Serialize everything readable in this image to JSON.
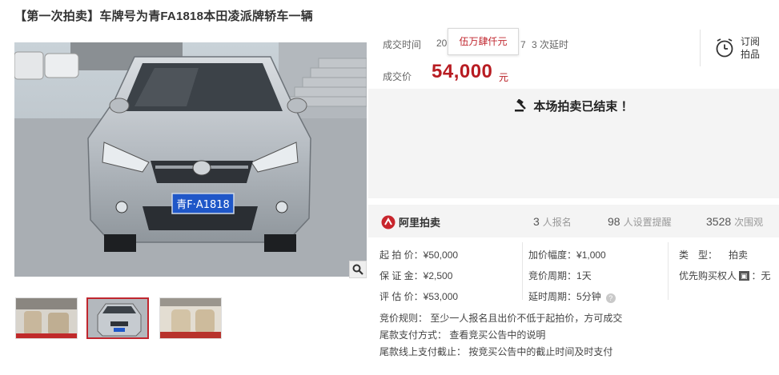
{
  "title": "【第一次拍卖】车牌号为青FA1818本田凌派牌轿车一辆",
  "photos": {
    "main_alt": "青FA1818 本田凌派",
    "plate_text": "青F·A1818",
    "thumbnails": [
      "interior-front",
      "exterior-front",
      "interior-rear"
    ],
    "active_index": 1
  },
  "deal": {
    "time_label": "成交时间",
    "time_value_prefix": "20",
    "time_value_suffix": "7",
    "delay_text": "3 次延时",
    "tooltip": "伍万肆仟元",
    "price_label": "成交价",
    "price": "54,000",
    "price_unit": "元"
  },
  "subscribe": {
    "label": "订阅拍品"
  },
  "status": {
    "ended_text": "本场拍卖已结束 ！"
  },
  "stats": {
    "logo_text": "阿里拍卖",
    "signups": "3",
    "signups_label": "人报名",
    "reminders": "98",
    "reminders_label": "人设置提醒",
    "views": "3528",
    "views_label": "次围观"
  },
  "details": {
    "start_price_label": "起 拍 价：",
    "start_price": "¥50,000",
    "deposit_label": "保 证 金：",
    "deposit": "¥2,500",
    "appraisal_label": "评 估 价：",
    "appraisal": "¥53,000",
    "increment_label": "加价幅度：",
    "increment": "¥1,000",
    "cycle_label": "竞价周期：",
    "cycle": "1天",
    "delay_label": "延时周期：",
    "delay": "5分钟",
    "type_label": "类　型：",
    "type": "拍卖",
    "priority_label": "优先购买权人",
    "priority_badge": "▣",
    "priority_value": "：无"
  },
  "rules": {
    "rule1_label": "竞价规则：",
    "rule1": "至少一人报名且出价不低于起拍价，方可成交",
    "rule2_label": "尾款支付方式：",
    "rule2": "查看竞买公告中的说明",
    "rule3_label": "尾款线上支付截止：",
    "rule3": "按竞买公告中的截止时间及时支付"
  },
  "colors": {
    "accent": "#b81c22",
    "panel_bg": "#f4f4f4"
  }
}
